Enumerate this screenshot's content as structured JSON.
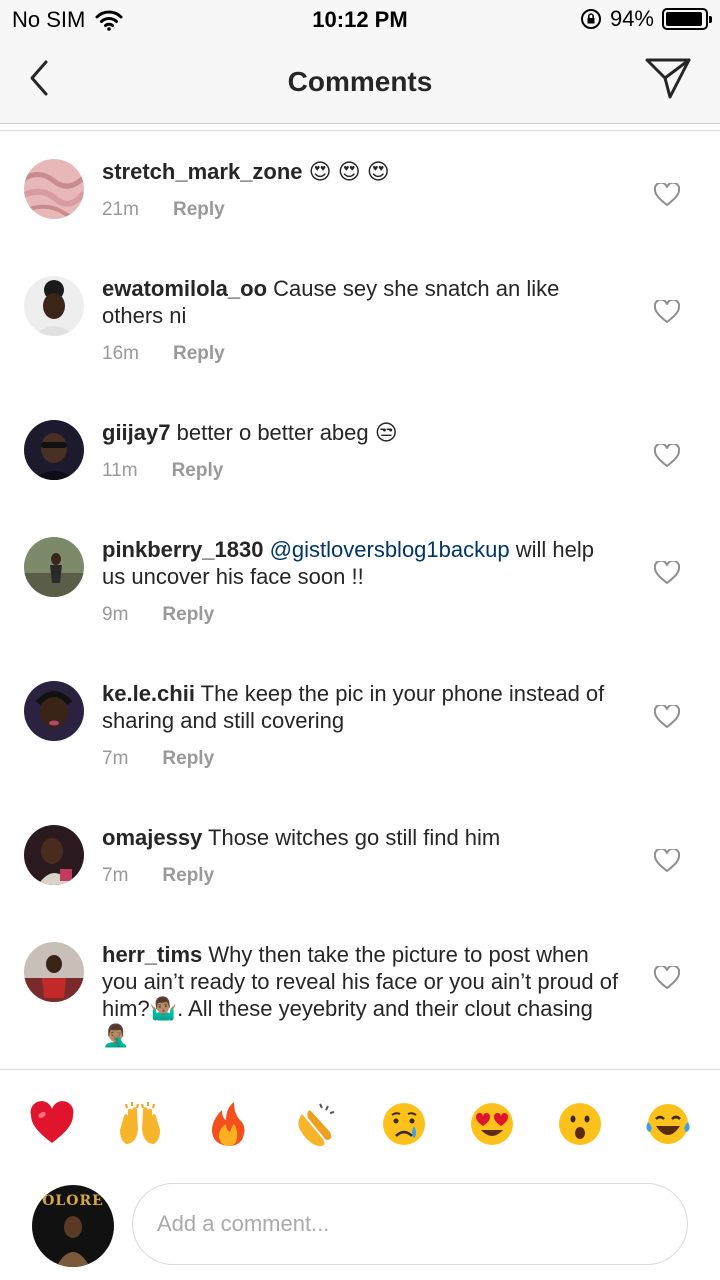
{
  "status_bar": {
    "carrier": "No SIM",
    "time": "10:12 PM",
    "battery_percent": "94%",
    "battery_level": 0.94
  },
  "header": {
    "title": "Comments",
    "back_icon": "chevron-left-icon",
    "send_icon": "paper-plane-icon"
  },
  "comments": [
    {
      "username": "stretch_mark_zone",
      "text": "",
      "mention": "",
      "text_after": "",
      "emojis": "😍 😍 😍",
      "time": "21m",
      "reply": "Reply"
    },
    {
      "username": "ewatomilola_oo",
      "text": "Cause sey she snatch an like others ni",
      "mention": "",
      "text_after": "",
      "emojis": "",
      "time": "16m",
      "reply": "Reply"
    },
    {
      "username": "giijay7",
      "text": "better o better abeg",
      "mention": "",
      "text_after": "",
      "emojis": "😒",
      "time": "11m",
      "reply": "Reply"
    },
    {
      "username": "pinkberry_1830",
      "text": "",
      "mention": "@gistloversblog1backup",
      "text_after": "will help us uncover his face soon !!",
      "emojis": "",
      "time": "9m",
      "reply": "Reply"
    },
    {
      "username": "ke.le.chii",
      "text": "The keep the pic in your phone instead of sharing and still covering",
      "mention": "",
      "text_after": "",
      "emojis": "",
      "time": "7m",
      "reply": "Reply"
    },
    {
      "username": "omajessy",
      "text": "Those witches go still find him",
      "mention": "",
      "text_after": "",
      "emojis": "",
      "time": "7m",
      "reply": "Reply"
    },
    {
      "username": "herr_tims",
      "text": "Why then take the picture to post when you ain’t ready to reveal his face or you ain’t proud of him?🤷🏽‍♂️. All these yeyebrity and their clout chasing 🤦🏽‍♂️",
      "mention": "",
      "text_after": "",
      "emojis": "",
      "time": "",
      "reply": ""
    }
  ],
  "emoji_bar": [
    "❤️",
    "🙌",
    "🔥",
    "👏",
    "😢",
    "😍",
    "😮",
    "😂"
  ],
  "composer": {
    "placeholder": "Add a comment...",
    "avatar_text": "OLORE"
  }
}
